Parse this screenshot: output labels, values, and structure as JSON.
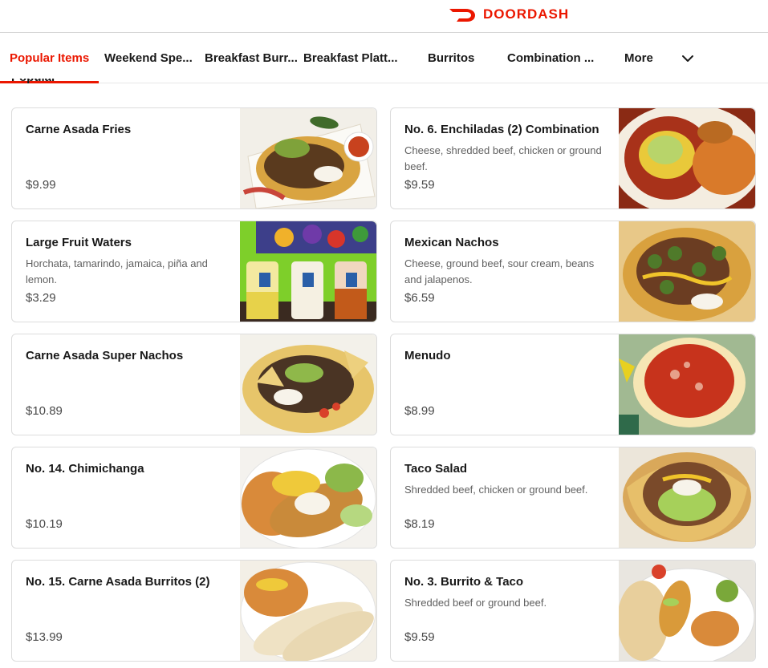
{
  "brand": {
    "name": "DOORDASH",
    "color": "#eb1700"
  },
  "tabs": [
    {
      "label": "Popular Items",
      "active": true
    },
    {
      "label": "Weekend Spe..."
    },
    {
      "label": "Breakfast Burr..."
    },
    {
      "label": "Breakfast Platt..."
    },
    {
      "label": "Burritos"
    },
    {
      "label": "Combination ..."
    }
  ],
  "more_label": "More",
  "section_title": "Popular Items",
  "items": [
    {
      "name": "Carne Asada Fries",
      "description": "",
      "price": "$9.99",
      "image": "carne-asada-fries"
    },
    {
      "name": "No. 6. Enchiladas (2) Combination",
      "description": "Cheese, shredded beef, chicken or ground beef.",
      "price": "$9.59",
      "image": "enchiladas-combination"
    },
    {
      "name": "Large Fruit Waters",
      "description": "Horchata, tamarindo, jamaica, piña and lemon.",
      "price": "$3.29",
      "image": "fruit-waters"
    },
    {
      "name": "Mexican Nachos",
      "description": "Cheese, ground beef, sour cream, beans and jalapenos.",
      "price": "$6.59",
      "image": "mexican-nachos"
    },
    {
      "name": "Carne Asada Super Nachos",
      "description": "",
      "price": "$10.89",
      "image": "super-nachos"
    },
    {
      "name": "Menudo",
      "description": "",
      "price": "$8.99",
      "image": "menudo"
    },
    {
      "name": "No. 14. Chimichanga",
      "description": "",
      "price": "$10.19",
      "image": "chimichanga"
    },
    {
      "name": "Taco Salad",
      "description": "Shredded beef, chicken or ground beef.",
      "price": "$8.19",
      "image": "taco-salad"
    },
    {
      "name": "No. 15. Carne Asada Burritos (2)",
      "description": "",
      "price": "$13.99",
      "image": "burritos"
    },
    {
      "name": "No. 3. Burrito & Taco",
      "description": "Shredded beef or ground beef.",
      "price": "$9.59",
      "image": "burrito-taco"
    }
  ]
}
